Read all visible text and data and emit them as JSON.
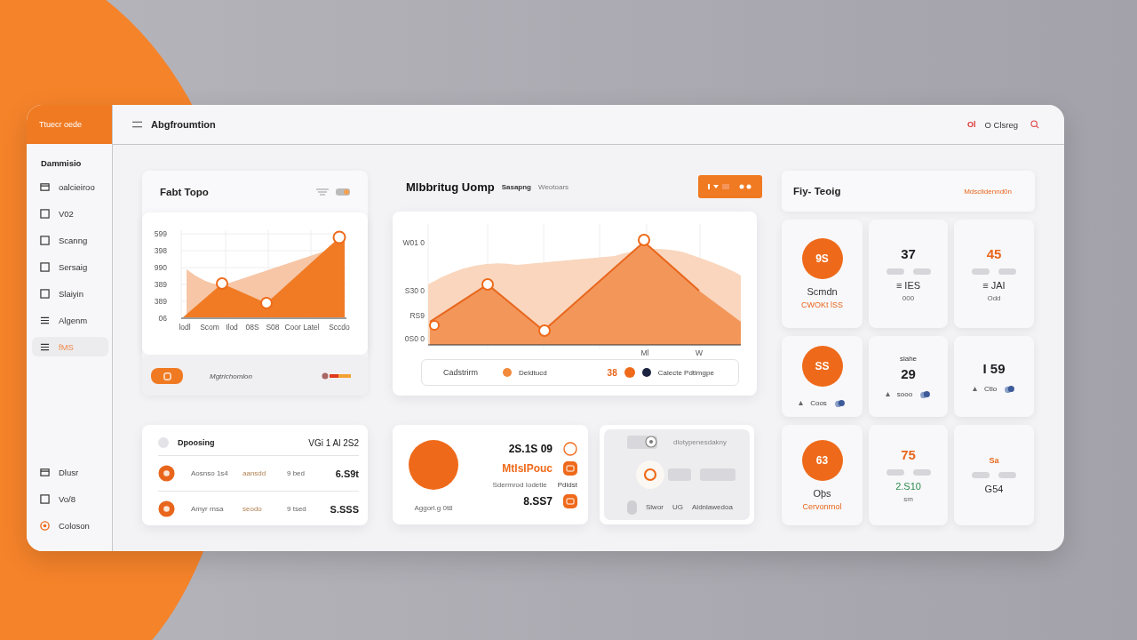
{
  "sidebar": {
    "brand": "Ttuecr oede",
    "section": "Dammisio",
    "items": [
      {
        "kind": "window",
        "label": "oalcieiroo",
        "selected": false
      },
      {
        "kind": "square",
        "label": "V02",
        "selected": false
      },
      {
        "kind": "square",
        "label": "Scanng",
        "selected": false
      },
      {
        "kind": "square",
        "label": "Sersaig",
        "selected": false
      },
      {
        "kind": "square",
        "label": "Slaiyin",
        "selected": false
      },
      {
        "kind": "menu",
        "label": "Algenm",
        "selected": false
      },
      {
        "kind": "menu",
        "label": "fMS",
        "selected": true
      }
    ],
    "bottom_items": [
      {
        "kind": "window",
        "label": "Dlusr",
        "selected": false
      },
      {
        "kind": "square",
        "label": "Vo/8",
        "selected": false
      },
      {
        "kind": "target",
        "label": "Coloson",
        "selected": false
      }
    ]
  },
  "header": {
    "title": "Abgfroumtion",
    "badge": "Ol",
    "account": "O Clsreg"
  },
  "trend_panel": {
    "title": "Fabt Topo",
    "toggle_on": true,
    "y_labels": [
      "599",
      "398",
      "990",
      "389",
      "389",
      "06"
    ],
    "x_labels": [
      "lodl",
      "Scom",
      "Ilod",
      "08S",
      "S08",
      "Coor Latel",
      "Sccdo"
    ],
    "footer_text": "Mgtrichomlon"
  },
  "main_chart": {
    "title": "Mlbbritug Uomp",
    "subtitle": "Sasapng",
    "note": "Weotoars",
    "y_labels": [
      "W01 0",
      "S30 0",
      "RS9",
      "0S0 0"
    ],
    "x_labels": [
      "Ml",
      "W"
    ],
    "legend": [
      {
        "kind": "text",
        "label": "Cadstrirm"
      },
      {
        "kind": "dot",
        "label": "Deldtucd",
        "color": "#f28a3c"
      },
      {
        "kind": "value",
        "label": "38"
      },
      {
        "kind": "icon",
        "color": "#ee6a1a"
      },
      {
        "kind": "dot",
        "label": "Calecte Pdtlmgpe",
        "color": "#1c2340"
      }
    ]
  },
  "list_card": {
    "title": "Dpoosing",
    "total": "VGi 1 Al 2S2",
    "rows": [
      {
        "name": "Aosnso 1s4",
        "tag": "aansdd",
        "count": "9 bed",
        "amount": "6.S9t"
      },
      {
        "name": "Amyr rnsa",
        "tag": "seodo",
        "count": "9 tsed",
        "amount": "S.SSS"
      }
    ]
  },
  "summary_card": {
    "caption": "Aggorl.g 0t8",
    "lines": [
      {
        "kind": "outline",
        "text": "2S.1S 09"
      },
      {
        "kind": "accent",
        "text": "MtlsIPouc"
      },
      {
        "kind": "note",
        "text": "Sdermrod Iodetle",
        "side": "Pdidst"
      },
      {
        "kind": "filled",
        "text": "8.SS7"
      }
    ]
  },
  "control_card": {
    "hint": "dlotypenesdakny",
    "labels": [
      "Slwor",
      "UG",
      "Aldnlawedoa"
    ]
  },
  "stats": {
    "title": "Fiy- Teoig",
    "link": "Mdsclidennd0n",
    "cards": [
      {
        "kind": "circle",
        "value": "9S",
        "label": "Scmdn",
        "sub": "CWOKt lSS"
      },
      {
        "kind": "number",
        "value": "37",
        "color": "#1e1e24",
        "label": "≡ IES",
        "sub": "000"
      },
      {
        "kind": "number",
        "value": "45",
        "color": "#e8661c",
        "label": "≡ JAI",
        "sub": "Odd"
      },
      {
        "kind": "circle",
        "value": "SS",
        "foot": "Coos"
      },
      {
        "kind": "number",
        "value": "29",
        "color": "#1e1e24",
        "top": "slahe",
        "foot": "sooo"
      },
      {
        "kind": "number",
        "value": "I 59",
        "color": "#1e1e24",
        "foot": "Ctlo"
      },
      {
        "kind": "circle",
        "value": "63",
        "label": "Oþs",
        "sub": "Cervonrnol"
      },
      {
        "kind": "number",
        "value": "75",
        "color": "#e8661c",
        "label": {
          "text": "2.S10",
          "color": "#2e8b4e"
        },
        "sub": "sm"
      },
      {
        "kind": "number",
        "value": "Sa",
        "color": "#e8661c",
        "small": true,
        "label": "G54"
      }
    ]
  }
}
